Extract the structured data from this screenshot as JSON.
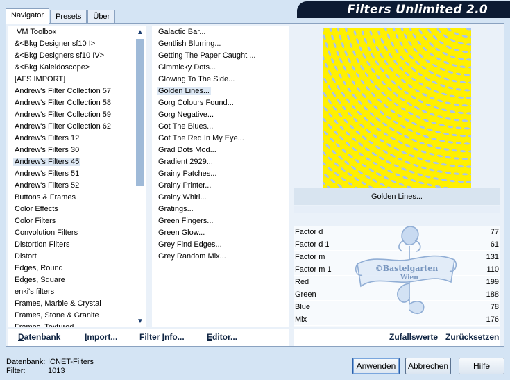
{
  "title": "Filters Unlimited 2.0",
  "tabs": [
    "Navigator",
    "Presets",
    "Über"
  ],
  "categories": [
    "VM Toolbox",
    "&<Bkg Designer sf10 I>",
    "&<Bkg Designers sf10 IV>",
    "&<Bkg Kaleidoscope>",
    "[AFS IMPORT]",
    "Andrew's Filter Collection 57",
    "Andrew's Filter Collection 58",
    "Andrew's Filter Collection 59",
    "Andrew's Filter Collection 62",
    "Andrew's Filters 12",
    "Andrew's Filters 30",
    "Andrew's Filters 45",
    "Andrew's Filters 51",
    "Andrew's Filters 52",
    "Buttons & Frames",
    "Color Effects",
    "Color Filters",
    "Convolution Filters",
    "Distortion Filters",
    "Distort",
    "Edges, Round",
    "Edges, Square",
    "enki's filters",
    "Frames, Marble & Crystal",
    "Frames, Stone & Granite",
    "Frames, Textured"
  ],
  "filters": [
    "Galactic Bar...",
    "Gentlish Blurring...",
    "Getting The Paper Caught ...",
    "Gimmicky Dots...",
    "Glowing To The Side...",
    "Golden Lines...",
    "Gorg Colours Found...",
    "Gorg Negative...",
    "Got The Blues...",
    "Got The Red In My Eye...",
    "Grad Dots Mod...",
    "Gradient 2929...",
    "Grainy Patches...",
    "Grainy Printer...",
    "Grainy Whirl...",
    "Gratings...",
    "Green Fingers...",
    "Green Glow...",
    "Grey Find Edges...",
    "Grey Random Mix..."
  ],
  "selected_filter": "Golden Lines...",
  "params": [
    {
      "name": "Factor d",
      "value": "77"
    },
    {
      "name": "Factor d 1",
      "value": "61"
    },
    {
      "name": "Factor m",
      "value": "131"
    },
    {
      "name": "Factor m 1",
      "value": "110"
    },
    {
      "name": "Red",
      "value": "199"
    },
    {
      "name": "Green",
      "value": "188"
    },
    {
      "name": "Blue",
      "value": "78"
    },
    {
      "name": "Mix",
      "value": "176"
    }
  ],
  "left_buttons": {
    "db_first": "D",
    "db_rest": "atenbank",
    "imp_first": "I",
    "imp_rest": "mport...",
    "info_pre": "Filter ",
    "info_u": "I",
    "info_post": "nfo...",
    "ed_first": "E",
    "ed_rest": "ditor..."
  },
  "right_buttons": {
    "random": "Zufallswerte",
    "reset": "Zurücksetzen"
  },
  "status": {
    "db_label": "Datenbank:",
    "db_value": "ICNET-Filters",
    "filter_label": "Filter:",
    "filter_value": "1013"
  },
  "dialog_buttons": {
    "apply": "Anwenden",
    "cancel": "Abbrechen",
    "help": "Hilfe"
  },
  "watermark": {
    "line1": "©Bastelgarten",
    "line2": "Wien"
  },
  "colors": {
    "preview_yellow": "#fff000",
    "preview_blue": "#a9c4ea",
    "banner": "#0c1b33"
  }
}
